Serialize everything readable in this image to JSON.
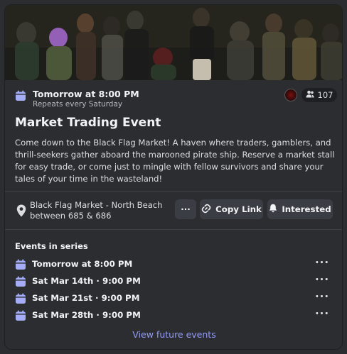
{
  "event": {
    "when": "Tomorrow at 8:00 PM",
    "repeats": "Repeats every Saturday",
    "interested_count": "107",
    "title": "Market Trading Event",
    "description": "Come down to the Black Flag Market! A haven where traders, gamblers, and thrill-seekers gather aboard the marooned pirate ship. Reserve a market stall for easy trade, or come just to mingle with fellow survivors and share your tales of your time in the wasteland!",
    "location_line1": "Black Flag Market - North Beach",
    "location_line2": "between 685 & 686"
  },
  "actions": {
    "more_label": "···",
    "copy_link_label": "Copy Link",
    "interested_label": "Interested"
  },
  "series": {
    "heading": "Events in series",
    "items": [
      {
        "label": "Tomorrow at 8:00 PM"
      },
      {
        "label": "Sat Mar 14th · 9:00 PM"
      },
      {
        "label": "Sat Mar 21st · 9:00 PM"
      },
      {
        "label": "Sat Mar 28th · 9:00 PM"
      }
    ],
    "more_label": "···",
    "view_future_label": "View future events"
  },
  "colors": {
    "accent": "#949cf7",
    "calendar_icon": "#a5adf7",
    "card_bg": "#2b2d31",
    "button_bg": "#3b3d44"
  },
  "icons": {
    "calendar": "calendar-icon",
    "interested_users": "users-icon",
    "location": "location-pin-icon",
    "link": "link-icon",
    "bell": "bell-icon",
    "more": "more-horizontal-icon"
  }
}
